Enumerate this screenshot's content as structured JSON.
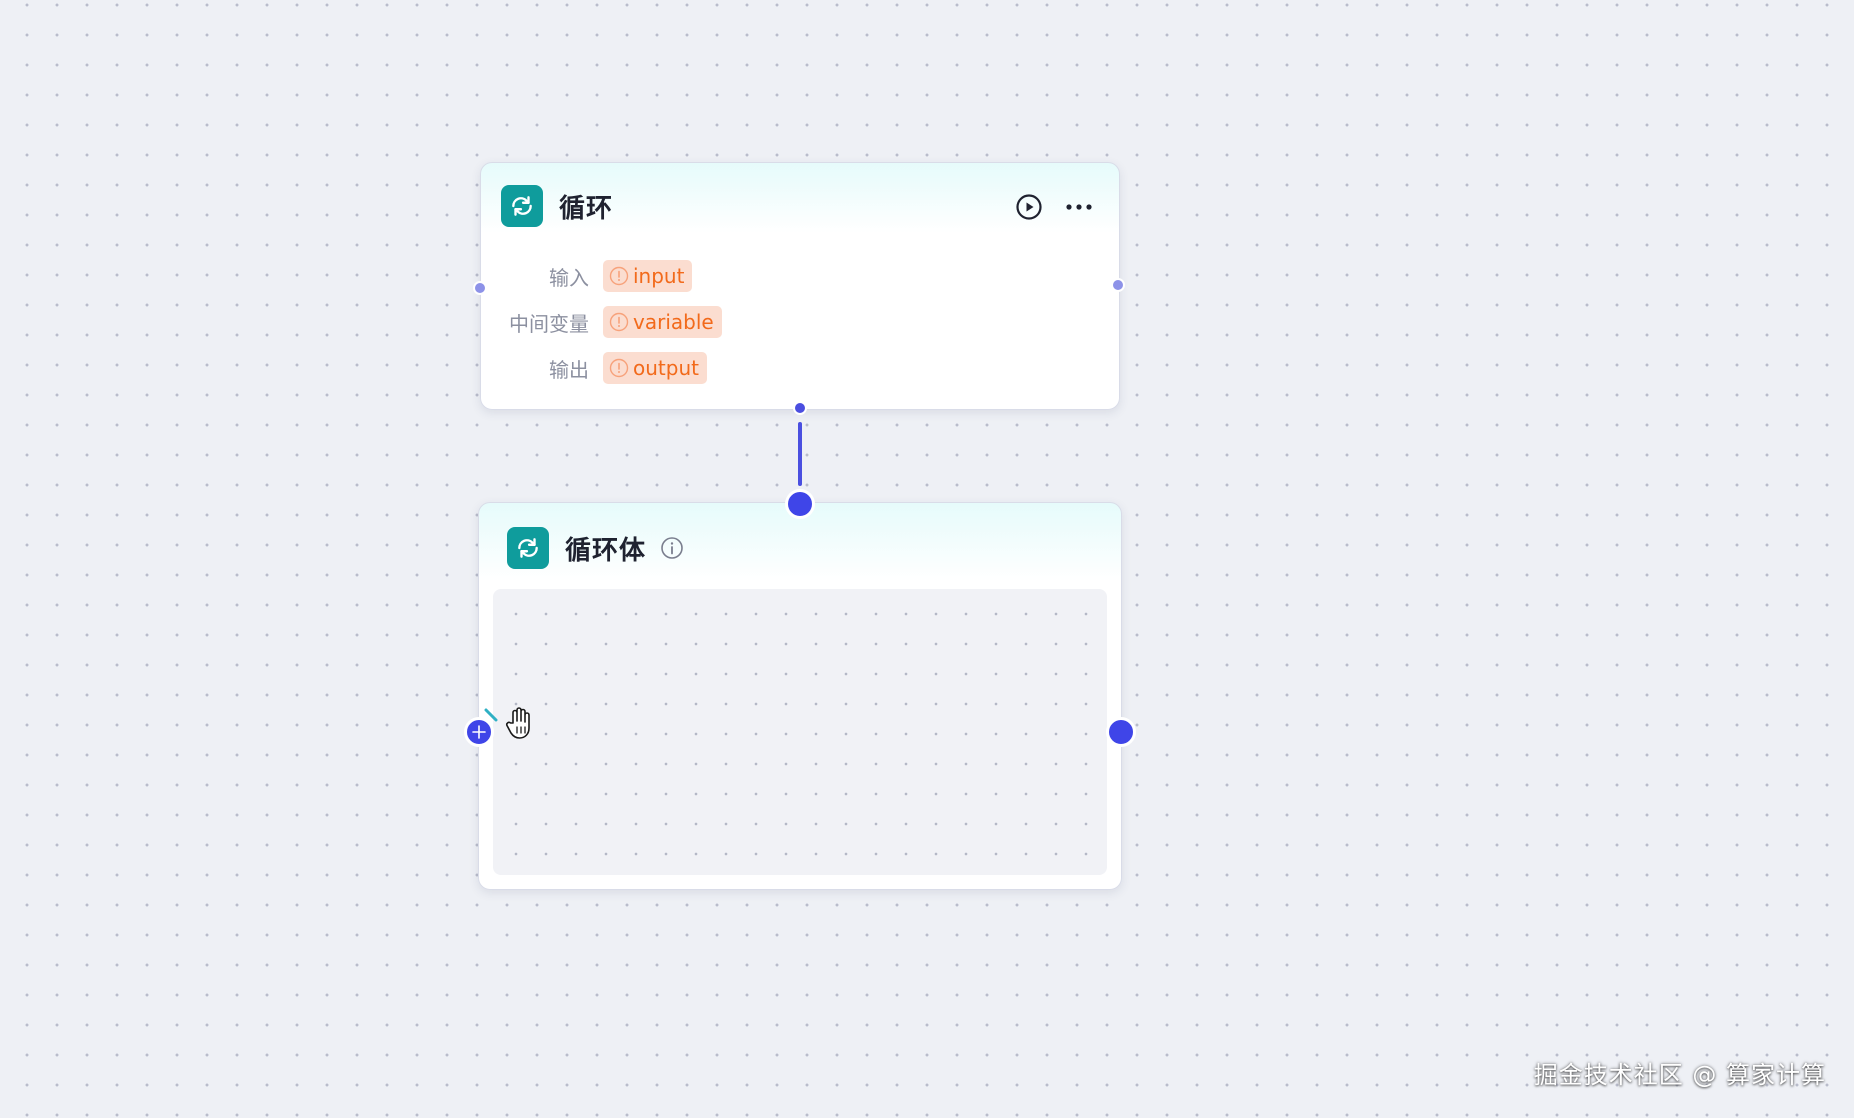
{
  "loop_node": {
    "title": "循环",
    "icon": "loop-icon",
    "actions": [
      {
        "name": "run",
        "icon": "play-circle-icon"
      },
      {
        "name": "more",
        "icon": "more-horizontal-icon"
      }
    ],
    "params": [
      {
        "label": "输入",
        "value": "input",
        "icon": "warning-circle-icon"
      },
      {
        "label": "中间变量",
        "value": "variable",
        "icon": "warning-circle-icon"
      },
      {
        "label": "输出",
        "value": "output",
        "icon": "warning-circle-icon"
      }
    ]
  },
  "loop_body_node": {
    "title": "循环体",
    "icon": "loop-icon",
    "info_icon": "info-circle-icon"
  },
  "colors": {
    "accent": "#3f45e8",
    "icon_bg": "#0f9c9c",
    "tag_bg": "#fbddd0",
    "tag_text": "#f26a1b",
    "canvas_bg": "#eef0f5"
  },
  "watermark": "掘金技术社区 @ 算家计算"
}
